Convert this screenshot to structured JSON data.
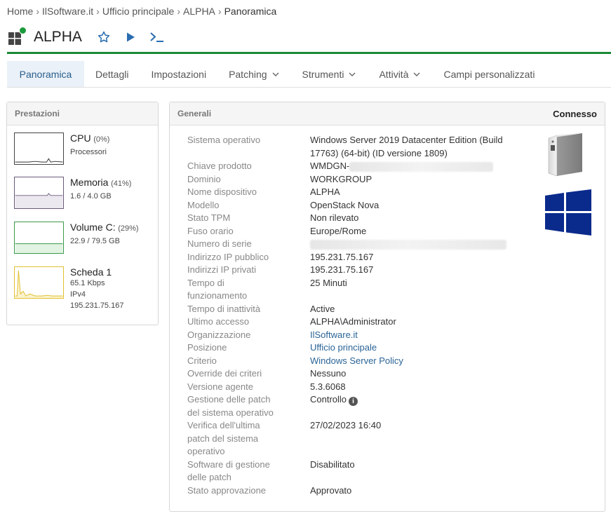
{
  "breadcrumb": {
    "home": "Home",
    "org": "IlSoftware.it",
    "location": "Ufficio principale",
    "device": "ALPHA",
    "current": "Panoramica"
  },
  "device": {
    "name": "ALPHA",
    "status_color": "#1a9b3a"
  },
  "toolbar": {
    "favorite_icon": "star-icon",
    "run_icon": "play-icon",
    "terminal_icon": "terminal-icon"
  },
  "tabs": [
    {
      "label": "Panoramica"
    },
    {
      "label": "Dettagli"
    },
    {
      "label": "Impostazioni"
    },
    {
      "label": "Patching"
    },
    {
      "label": "Strumenti"
    },
    {
      "label": "Attività"
    },
    {
      "label": "Campi personalizzati"
    }
  ],
  "performance": {
    "title": "Prestazioni",
    "cpu": {
      "name": "CPU",
      "pct": "(0%)",
      "sub": "Processori"
    },
    "memory": {
      "name": "Memoria",
      "pct": "(41%)",
      "sub": "1.6 / 4.0 GB"
    },
    "volume": {
      "name": "Volume C:",
      "pct": "(29%)",
      "sub": "22.9 / 79.5 GB"
    },
    "network": {
      "name": "Scheda 1",
      "speed": "65.1 Kbps",
      "proto": "IPv4",
      "ip": "195.231.75.167"
    }
  },
  "general": {
    "title": "Generali",
    "status": "Connesso",
    "os_label": "Sistema operativo",
    "os_value": "Windows Server 2019 Datacenter Edition (Build 17763) (64-bit) (ID versione 1809)",
    "product_key_label": "Chiave prodotto",
    "product_key_value": "WMDGN-",
    "domain_label": "Dominio",
    "domain_value": "WORKGROUP",
    "device_name_label": "Nome dispositivo",
    "device_name_value": "ALPHA",
    "model_label": "Modello",
    "model_value": "OpenStack Nova",
    "tpm_label": "Stato TPM",
    "tpm_value": "Non rilevato",
    "tz_label": "Fuso orario",
    "tz_value": "Europe/Rome",
    "serial_label": "Numero di serie",
    "public_ip_label": "Indirizzo IP pubblico",
    "public_ip_value": "195.231.75.167",
    "private_ip_label": "Indirizzi IP privati",
    "private_ip_value": "195.231.75.167",
    "uptime_label": "Tempo di funzionamento",
    "uptime_value": "25 Minuti",
    "idle_label": "Tempo di inattività",
    "idle_value": "Active",
    "last_access_label": "Ultimo accesso",
    "last_access_value": "ALPHA\\Administrator",
    "org_label": "Organizzazione",
    "org_value": "IlSoftware.it",
    "position_label": "Posizione",
    "position_value": "Ufficio principale",
    "policy_label": "Criterio",
    "policy_value": "Windows Server Policy",
    "override_label": "Override dei criteri",
    "override_value": "Nessuno",
    "agent_label": "Versione agente",
    "agent_value": "5.3.6068",
    "patch_mgmt_label": "Gestione delle patch del sistema operativo",
    "patch_mgmt_value": "Controllo",
    "patch_check_label": "Verifica dell'ultima patch del sistema operativo",
    "patch_check_value": "27/02/2023 16:40",
    "sw_patch_label": "Software di gestione delle patch",
    "sw_patch_value": "Disabilitato",
    "approval_label": "Stato approvazione",
    "approval_value": "Approvato"
  }
}
